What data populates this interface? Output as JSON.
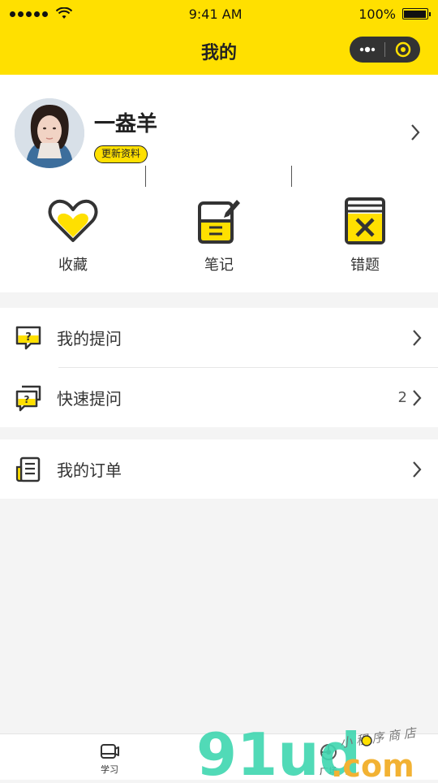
{
  "status_bar": {
    "time": "9:41 AM",
    "battery": "100%"
  },
  "nav": {
    "title": "我的"
  },
  "profile": {
    "name": "一盎羊",
    "update_label": "更新资料"
  },
  "quick_actions": [
    {
      "label": "收藏",
      "icon": "heart-icon"
    },
    {
      "label": "笔记",
      "icon": "note-icon"
    },
    {
      "label": "错题",
      "icon": "wrong-book-icon"
    }
  ],
  "menu": {
    "my_questions": {
      "label": "我的提问",
      "icon": "question-bubble-icon"
    },
    "quick_question": {
      "label": "快速提问",
      "icon": "quick-question-icon",
      "count": "2"
    },
    "my_orders": {
      "label": "我的订单",
      "icon": "order-icon"
    }
  },
  "tabs": [
    {
      "label": "学习",
      "icon": "study-icon"
    },
    {
      "label": "广场",
      "icon": "square-icon"
    }
  ],
  "watermark": {
    "brand": "91ud",
    "tld": ".com",
    "tagline": "小程序商店"
  },
  "colors": {
    "accent": "#ffe000",
    "dark": "#333333",
    "background": "#f4f4f4"
  }
}
